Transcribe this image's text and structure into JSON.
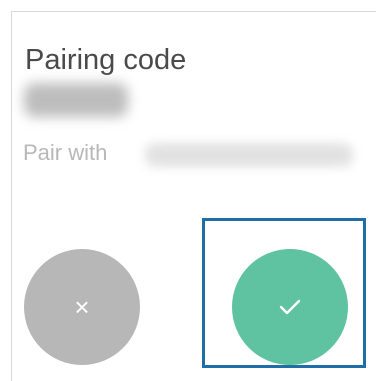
{
  "dialog": {
    "title": "Pairing code",
    "pairing_code": "",
    "pair_with_label": "Pair with",
    "device_name": ""
  },
  "actions": {
    "reject_icon": "close-icon",
    "reject_glyph": "×",
    "accept_icon": "check-icon"
  },
  "colors": {
    "reject": "#b7b7b8",
    "accept": "#5fc2a0",
    "highlight": "#1f6fa6"
  }
}
